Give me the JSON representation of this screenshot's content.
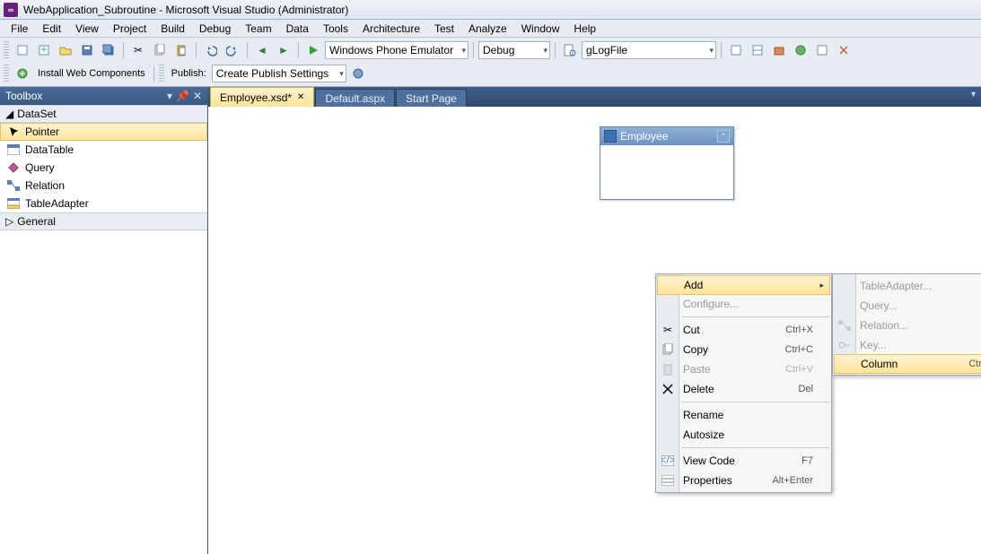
{
  "title": "WebApplication_Subroutine - Microsoft Visual Studio (Administrator)",
  "menu": [
    "File",
    "Edit",
    "View",
    "Project",
    "Build",
    "Debug",
    "Team",
    "Data",
    "Tools",
    "Architecture",
    "Test",
    "Analyze",
    "Window",
    "Help"
  ],
  "toolbar": {
    "install_web": "Install Web Components",
    "publish_label": "Publish:",
    "publish_combo": "Create Publish Settings",
    "emulator": "Windows Phone Emulator",
    "config": "Debug",
    "find": "gLogFile"
  },
  "toolbox": {
    "title": "Toolbox",
    "categories": [
      {
        "name": "DataSet",
        "expanded": true,
        "items": [
          {
            "label": "Pointer",
            "selected": true
          },
          {
            "label": "DataTable"
          },
          {
            "label": "Query"
          },
          {
            "label": "Relation"
          },
          {
            "label": "TableAdapter"
          }
        ]
      },
      {
        "name": "General",
        "expanded": false
      }
    ]
  },
  "tabs": [
    {
      "label": "Employee.xsd*",
      "active": true,
      "close": true
    },
    {
      "label": "Default.aspx"
    },
    {
      "label": "Start Page"
    }
  ],
  "canvas": {
    "table_title": "Employee"
  },
  "ctx1": {
    "items": [
      {
        "label": "Add",
        "hover": true,
        "submenu": true
      },
      {
        "label": "Configure...",
        "disabled": true
      },
      {
        "sep": true
      },
      {
        "label": "Cut",
        "shortcut": "Ctrl+X",
        "icon": "cut"
      },
      {
        "label": "Copy",
        "shortcut": "Ctrl+C",
        "icon": "copy"
      },
      {
        "label": "Paste",
        "shortcut": "Ctrl+V",
        "icon": "paste",
        "disabled": true
      },
      {
        "label": "Delete",
        "shortcut": "Del",
        "icon": "delete"
      },
      {
        "sep": true
      },
      {
        "label": "Rename"
      },
      {
        "label": "Autosize"
      },
      {
        "sep": true
      },
      {
        "label": "View Code",
        "shortcut": "F7",
        "icon": "code"
      },
      {
        "label": "Properties",
        "shortcut": "Alt+Enter",
        "icon": "props"
      }
    ]
  },
  "ctx2": {
    "items": [
      {
        "label": "TableAdapter...",
        "disabled": true
      },
      {
        "label": "Query...",
        "disabled": true
      },
      {
        "label": "Relation...",
        "disabled": true,
        "icon": "relation"
      },
      {
        "label": "Key...",
        "disabled": true,
        "icon": "key"
      },
      {
        "label": "Column",
        "shortcut": "Ctrl+L",
        "hover": true
      }
    ]
  }
}
